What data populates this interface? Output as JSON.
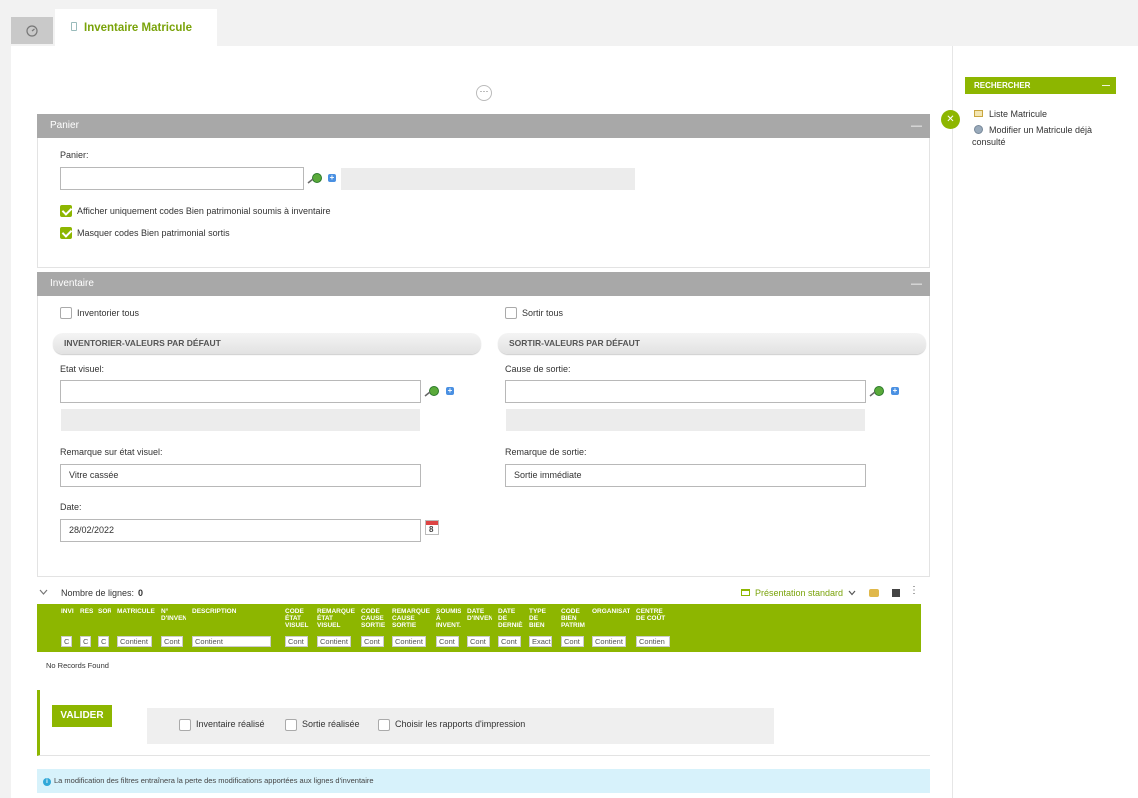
{
  "tabs": {
    "active_label": "Inventaire Matricule"
  },
  "panier": {
    "title": "Panier",
    "field_label": "Panier:",
    "field_value": "",
    "check1_label": "Afficher uniquement codes Bien patrimonial soumis à inventaire",
    "check1_checked": true,
    "check2_label": "Masquer codes Bien patrimonial sortis",
    "check2_checked": true
  },
  "inventaire": {
    "title": "Inventaire",
    "inventorier_tous": "Inventorier tous",
    "sortir_tous": "Sortir tous",
    "left_pill": "INVENTORIER-VALEURS PAR DÉFAUT",
    "right_pill": "SORTIR-VALEURS PAR DÉFAUT",
    "etat_visuel_label": "Etat visuel:",
    "etat_visuel_value": "",
    "cause_sortie_label": "Cause de sortie:",
    "cause_sortie_value": "",
    "remarque_etat_label": "Remarque sur état visuel:",
    "remarque_etat_value": "Vitre cassée",
    "remarque_sortie_label": "Remarque de sortie:",
    "remarque_sortie_value": "Sortie immédiate",
    "date_label": "Date:",
    "date_value": "28/02/2022",
    "calendar_day": "8"
  },
  "grid": {
    "nombre_label": "Nombre de lignes:",
    "nombre_value": "0",
    "presentation": "Présentation standard",
    "no_records": "No Records Found",
    "columns": [
      {
        "h": "INVI",
        "f": "C"
      },
      {
        "h": "RÉS",
        "f": "C"
      },
      {
        "h": "SOR",
        "f": "C"
      },
      {
        "h": "MATRICULE",
        "f": "Contient"
      },
      {
        "h": "N° D'INVEN",
        "f": "Cont"
      },
      {
        "h": "DESCRIPTION",
        "f": "Contient"
      },
      {
        "h": "CODE ÉTAT VISUEL",
        "f": "Cont"
      },
      {
        "h": "REMARQUE ÉTAT VISUEL",
        "f": "Contient"
      },
      {
        "h": "CODE CAUSE SORTIE",
        "f": "Cont"
      },
      {
        "h": "REMARQUE CAUSE SORTIE",
        "f": "Contient"
      },
      {
        "h": "SOUMIS À INVENT.",
        "f": "Cont"
      },
      {
        "h": "DATE D'INVEN",
        "f": "Cont"
      },
      {
        "h": "DATE DE DERNIÈ",
        "f": "Cont"
      },
      {
        "h": "TYPE DE BIEN",
        "f": "Exact"
      },
      {
        "h": "CODE BIEN PATRIM",
        "f": "Cont"
      },
      {
        "h": "ORGANISAT",
        "f": "Contient"
      },
      {
        "h": "CENTRE DE COÛT",
        "f": "Contien"
      }
    ]
  },
  "valider": {
    "button": "VALIDER",
    "opt1": "Inventaire réalisé",
    "opt2": "Sortie réalisée",
    "opt3": "Choisir les rapports d'impression"
  },
  "info": {
    "text": "La modification des filtres entraînera la perte des modifications apportées aux lignes d'inventaire",
    "icon": "i"
  },
  "right_panel": {
    "rechercher": "RECHERCHER",
    "link1": "Liste Matricule",
    "link2": "Modifier un Matricule déjà consulté"
  },
  "colors": {
    "accent": "#8db600",
    "section": "#a8a8a8",
    "info_bg": "#d7f2fb"
  }
}
